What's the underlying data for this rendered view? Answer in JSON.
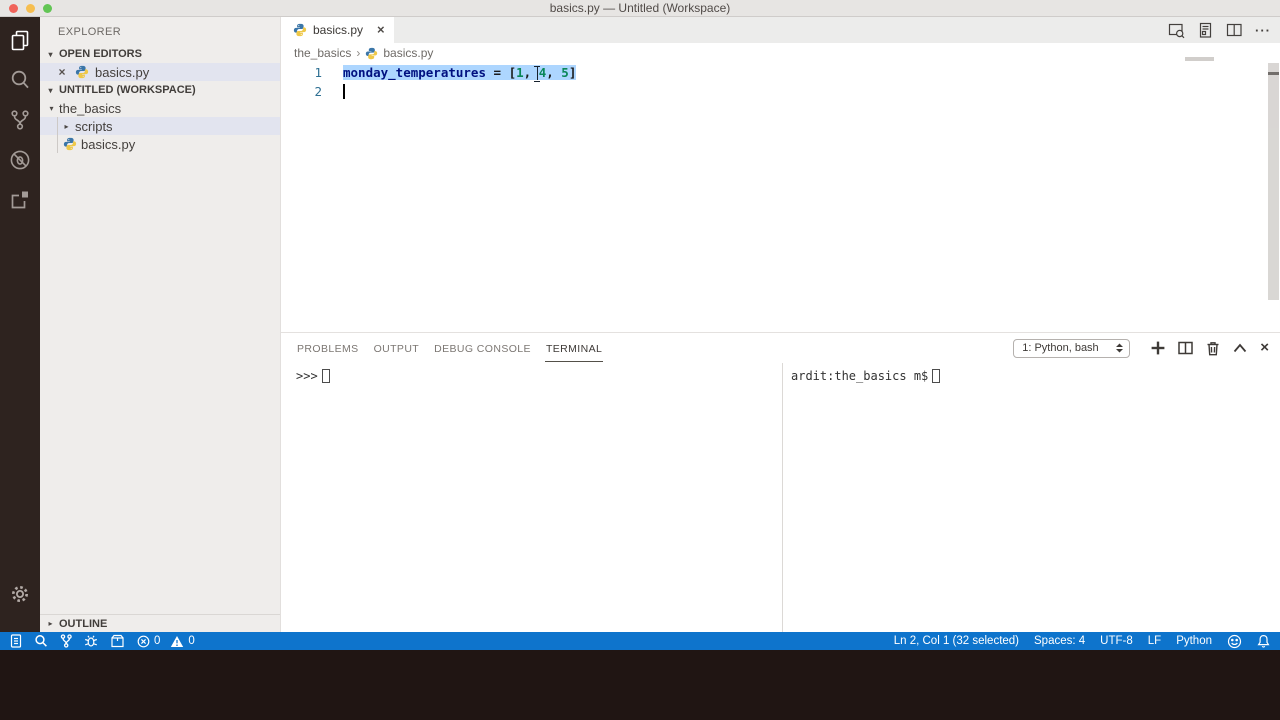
{
  "window": {
    "title": "basics.py — Untitled (Workspace)"
  },
  "sidebar": {
    "title": "EXPLORER",
    "open_editors_label": "OPEN EDITORS",
    "open_editor_file": "basics.py",
    "workspace_label": "UNTITLED (WORKSPACE)",
    "tree": {
      "root_folder": "the_basics",
      "sub_folder": "scripts",
      "file": "basics.py"
    },
    "outline_label": "OUTLINE"
  },
  "editor": {
    "tab_label": "basics.py",
    "breadcrumb": {
      "folder": "the_basics",
      "file": "basics.py"
    },
    "line_numbers": {
      "one": "1",
      "two": "2"
    },
    "code": {
      "variable": "monday_temperatures",
      "assign": " = [",
      "num1": "1",
      "sep1": ", ",
      "num2": "4",
      "sep2": ", ",
      "num3": "5",
      "close": "]"
    }
  },
  "panel": {
    "tabs": {
      "problems": "PROBLEMS",
      "output": "OUTPUT",
      "debug": "DEBUG CONSOLE",
      "terminal": "TERMINAL"
    },
    "active_tab": "TERMINAL",
    "terminal_selector": "1: Python, bash",
    "python_prompt": ">>>",
    "bash_prompt": "ardit:the_basics m$"
  },
  "status_bar": {
    "errors": "0",
    "warnings": "0",
    "cursor_position": "Ln 2, Col 1 (32 selected)",
    "indentation": "Spaces: 4",
    "encoding": "UTF-8",
    "eol": "LF",
    "language": "Python"
  },
  "icons": {
    "activity_bar": [
      "files-icon",
      "search-icon",
      "source-control-icon",
      "debug-icon",
      "extensions-icon",
      "gear-icon"
    ],
    "file_type": "python-icon",
    "editor_actions": [
      "open-changes-icon",
      "open-preview-icon",
      "split-editor-icon",
      "more-actions-icon"
    ],
    "terminal_toolbar": [
      "plus-icon",
      "split-terminal-icon",
      "trash-icon",
      "chevron-up-icon",
      "close-icon"
    ],
    "status_left": [
      "document-icon",
      "search-icon",
      "git-branch-icon",
      "bug-icon",
      "package-icon",
      "error-icon",
      "warning-icon"
    ],
    "status_right": [
      "smiley-icon",
      "bell-icon"
    ]
  },
  "colors": {
    "accent": "#0e74cc",
    "selection": "#add6ff",
    "token_variable": "#001080",
    "token_number": "#098658",
    "activity_bar_bg": "#2e231f",
    "sidebar_bg": "#efedeb",
    "list_selection_bg": "#e2e4ef",
    "desktop_bg": "#201513"
  }
}
